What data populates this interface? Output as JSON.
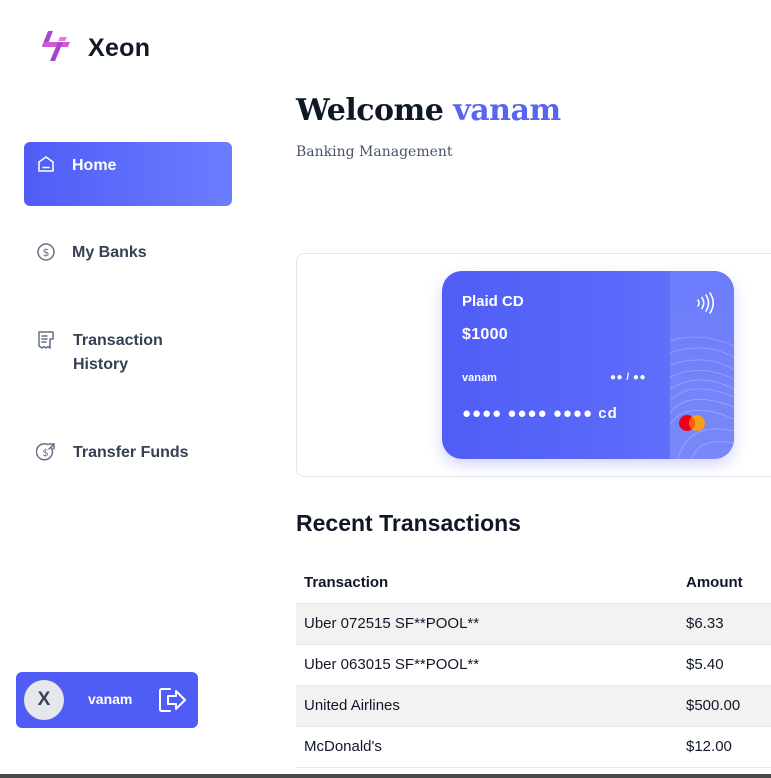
{
  "app": {
    "name": "Xeon",
    "logo_icon": "xeon-logo-icon"
  },
  "sidebar": {
    "items": [
      {
        "label": "Home",
        "icon": "home-icon",
        "active": true
      },
      {
        "label": "My Banks",
        "icon": "dollar-circle-icon",
        "active": false
      },
      {
        "label": "Transaction History",
        "icon": "receipt-icon",
        "active": false
      },
      {
        "label": "Transfer Funds",
        "icon": "transfer-dollar-icon",
        "active": false
      }
    ]
  },
  "user": {
    "initial": "X",
    "name": "vanam",
    "logout_icon": "logout-icon"
  },
  "header": {
    "welcome_prefix": "Welcome",
    "user_name": "vanam",
    "subtitle": "Banking Management"
  },
  "card": {
    "bank_name": "Plaid CD",
    "balance": "$1000",
    "owner": "vanam",
    "expiry": "●● / ●●",
    "number": "●●●● ●●●● ●●●● cd",
    "network_icon": "mastercard-icon",
    "contactless_icon": "contactless-icon"
  },
  "transactions": {
    "title": "Recent Transactions",
    "headers": [
      "Transaction",
      "Amount"
    ],
    "rows": [
      {
        "name": "Uber 072515 SF**POOL**",
        "amount": "$6.33",
        "type": "positive"
      },
      {
        "name": "Uber 063015 SF**POOL**",
        "amount": "$5.40",
        "type": "positive"
      },
      {
        "name": "United Airlines",
        "amount": "$500.00",
        "type": "negative"
      },
      {
        "name": "McDonald's",
        "amount": "$12.00",
        "type": "positive"
      }
    ]
  },
  "colors": {
    "accent": "#4f5df6",
    "positive": "#1f8a4c",
    "negative": "#d92d4a"
  }
}
